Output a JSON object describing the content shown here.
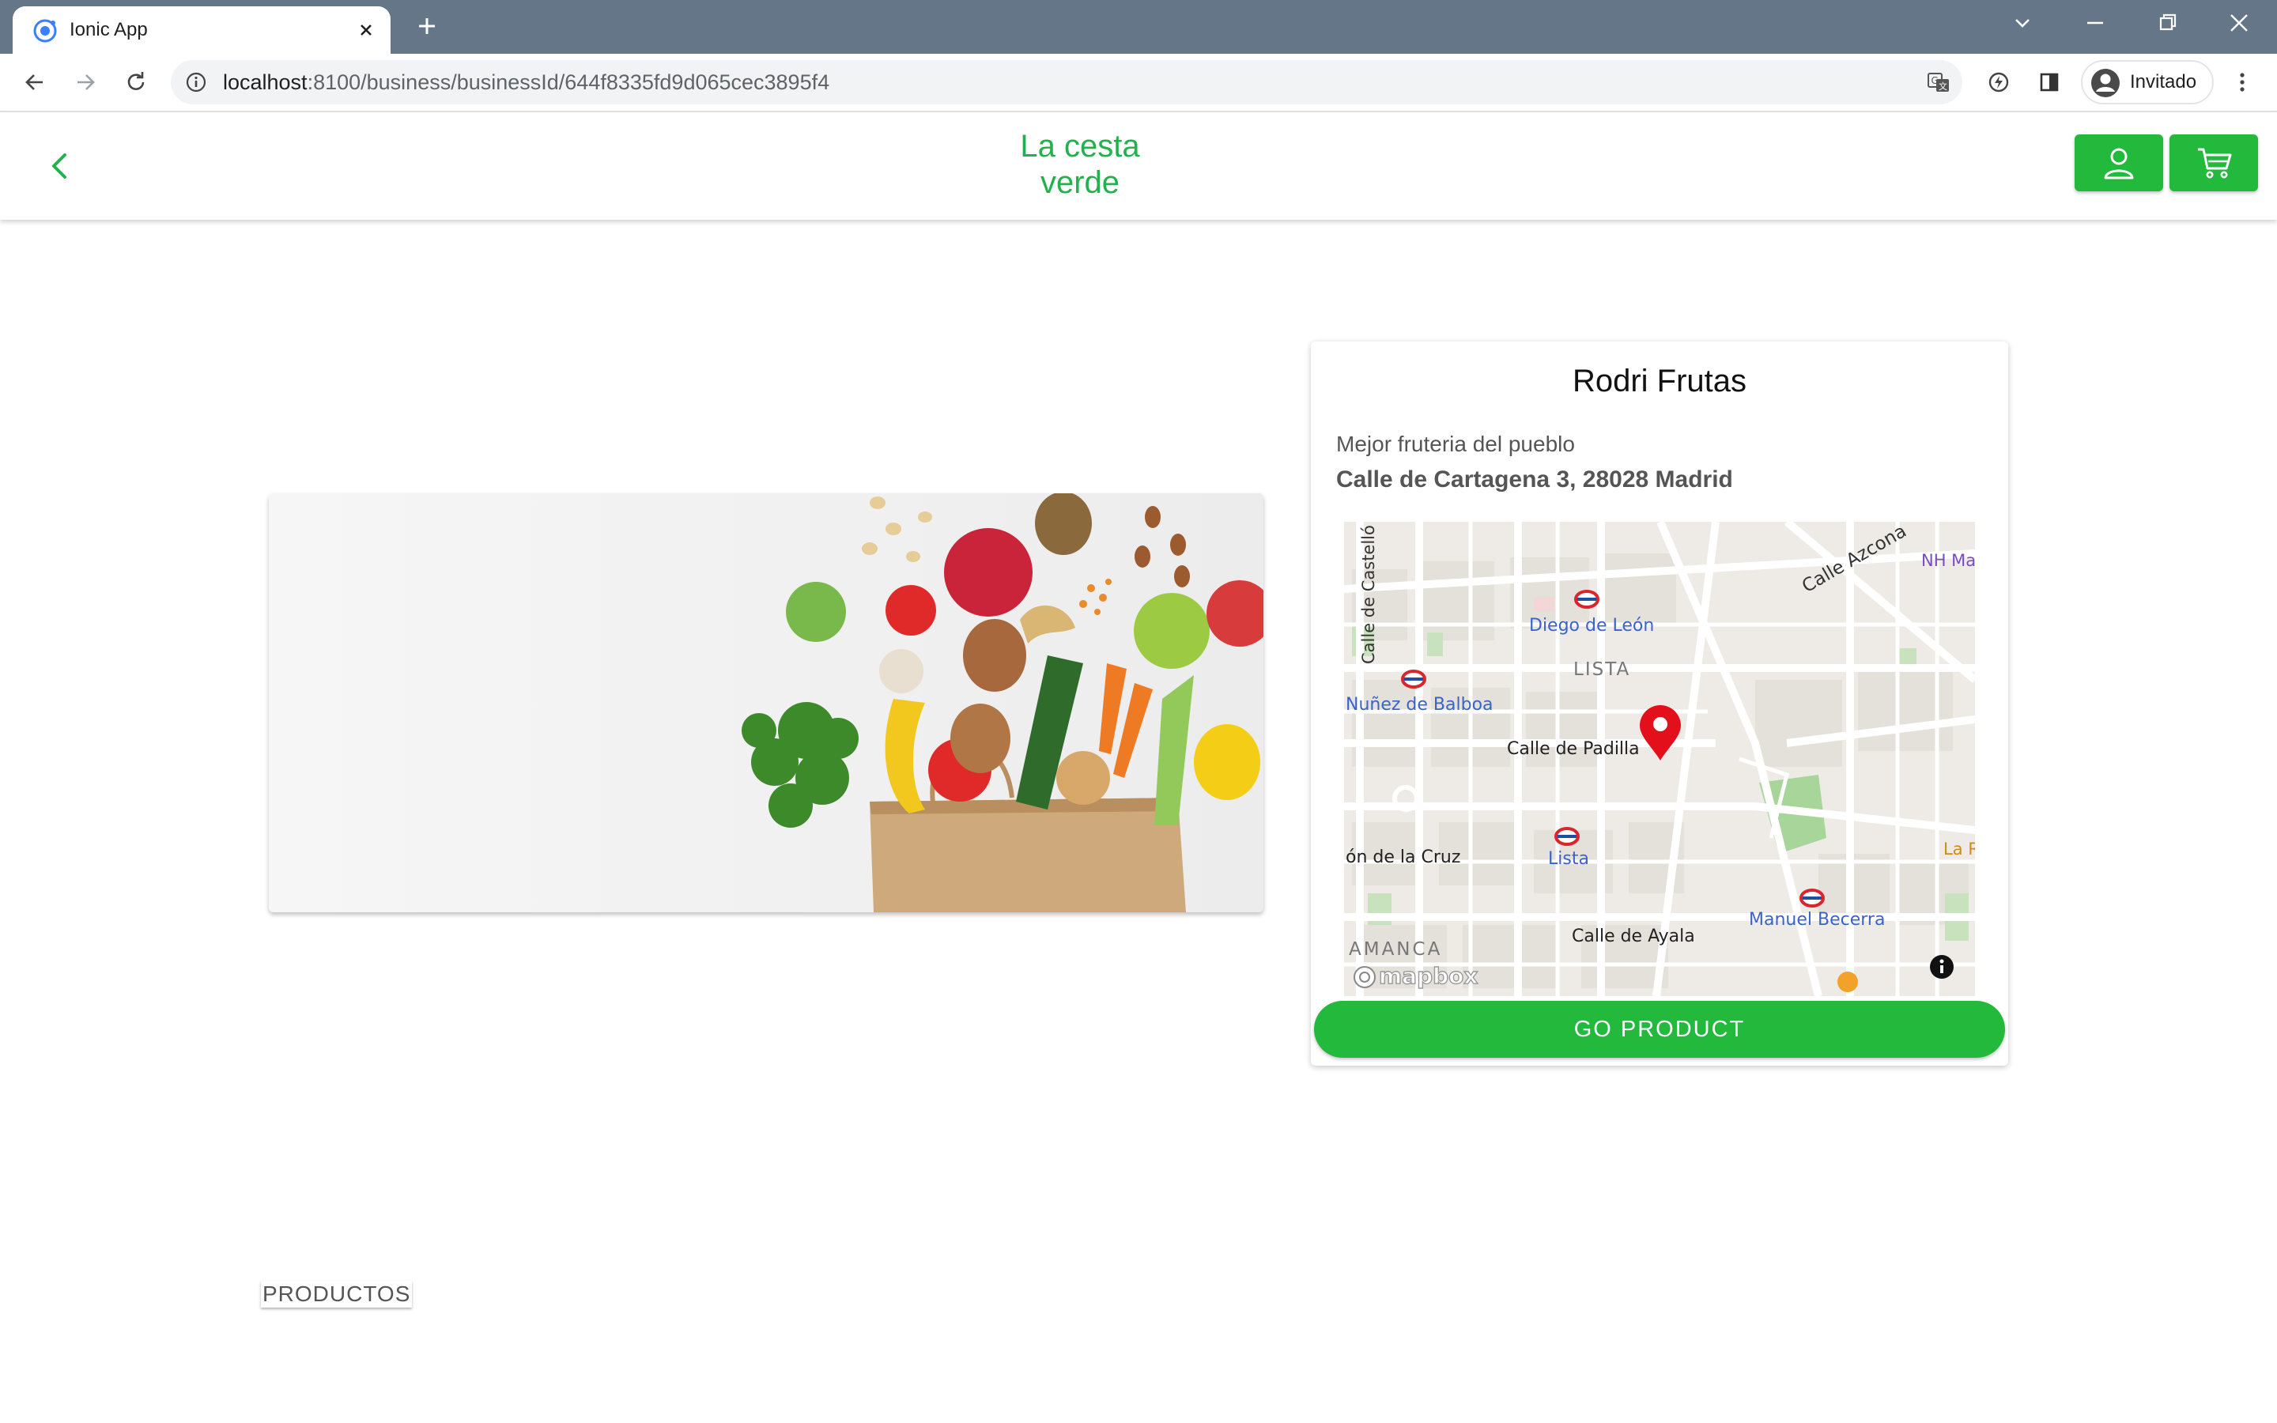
{
  "browser": {
    "tab_title": "Ionic App",
    "url_host": "localhost",
    "url_path": ":8100/business/businessId/644f8335fd9d065cec3895f4",
    "profile_label": "Invitado"
  },
  "app": {
    "title_line1": "La cesta",
    "title_line2": "verde",
    "accent_color": "#22b93d"
  },
  "business": {
    "name": "Rodri Frutas",
    "description": "Mejor fruteria del pueblo",
    "address": "Calle de Cartagena 3, 28028 Madrid",
    "go_button": "GO PRODUCT"
  },
  "map": {
    "labels": {
      "castello": "Calle de Castelló",
      "azcona": "Calle Azcona",
      "nh": "NH Ma",
      "diego": "Diego de León",
      "lista_area": "LISTA",
      "nunez": "Nuñez de Balboa",
      "padilla": "Calle de Padilla",
      "cruz": "ón de la Cruz",
      "lista": "Lista",
      "manuel": "Manuel Becerra",
      "ayala": "Calle de Ayala",
      "amanca": "AMANCA",
      "lar": "La R",
      "brand": "mapbox"
    }
  },
  "footer": {
    "productos_label": "PRODUCTOS"
  },
  "icons": {
    "favicon": "ionic-icon",
    "back": "chevron-left-icon",
    "user": "user-icon",
    "cart": "cart-icon",
    "marker": "map-pin-icon",
    "info": "info-icon"
  }
}
